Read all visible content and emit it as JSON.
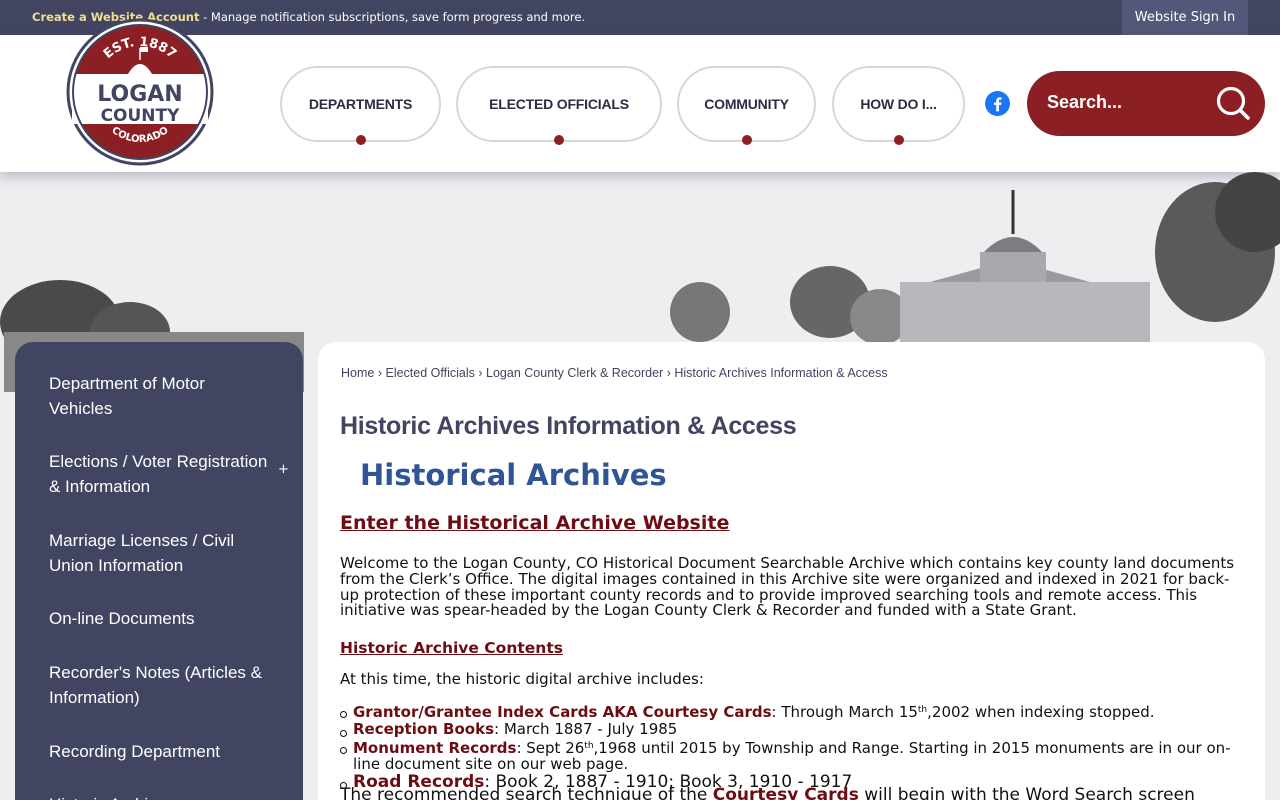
{
  "topbar": {
    "create_account": "Create a Website Account",
    "create_account_desc": " - Manage notification subscriptions, save form progress and more.",
    "sign_in": "Website Sign In"
  },
  "logo": {
    "est": "EST. 1887",
    "name_line1": "LOGAN",
    "name_line2": "COUNTY",
    "state": "COLORADO"
  },
  "nav": [
    {
      "label": "DEPARTMENTS"
    },
    {
      "label": "ELECTED OFFICIALS"
    },
    {
      "label": "COMMUNITY"
    },
    {
      "label": "HOW DO I..."
    }
  ],
  "search": {
    "placeholder": "Search..."
  },
  "sidebar": {
    "items": [
      {
        "label": "Department of Motor Vehicles"
      },
      {
        "label": "Elections / Voter Registration & Information",
        "expand": "+"
      },
      {
        "label": "Marriage Licenses / Civil Union Information"
      },
      {
        "label": "On-line Documents"
      },
      {
        "label": "Recorder's Notes (Articles & Information)"
      },
      {
        "label": "Recording Department"
      },
      {
        "label": "Historic Archives"
      }
    ]
  },
  "breadcrumb": {
    "items": [
      "Home",
      "Elected Officials",
      "Logan County Clerk & Recorder",
      "Historic Archives Information & Access"
    ],
    "separator": "›"
  },
  "main": {
    "page_title": "Historic Archives Information & Access",
    "heading": "Historical Archives",
    "enter_link": "Enter the Historical Archive Website",
    "paragraph": "Welcome to the Logan County, CO Historical Document Searchable Archive which contains key county land documents from the Clerk’s Office. The digital images contained in this Archive site were organized and indexed in 2021 for back-up protection of these important county records and to provide improved searching tools and remote access. This initiative was spear-headed by the Logan County Clerk & Recorder and funded with a State Grant.",
    "contents_link": "Historic Archive Contents ",
    "intro": "At this time, the historic digital archive includes:",
    "list": [
      {
        "title": "Grantor/Grantee Index Cards AKA Courtesy Cards",
        "pre": ": Through March 15",
        "sup": "th",
        "post": ",2002 when indexing stopped."
      },
      {
        "title": "Reception Books",
        "pre": ": March 1887 - July 1985",
        "sup": "",
        "post": ""
      },
      {
        "title": "Monument Records",
        "pre": ": Sept 26",
        "sup": "th",
        "post": ",1968 until 2015 by Township and Range. Starting in 2015 monuments are in our on-line document site on our web page."
      },
      {
        "title": "Road Records",
        "pre": ": Book 2, 1887 - 1910; Book 3, 1910 - 1917",
        "sup": "",
        "post": ""
      }
    ],
    "tail_pre": "The recommended search technique of the ",
    "tail_link": "Courtesy Cards",
    "tail_post": " will begin with the Word Search screen"
  },
  "colors": {
    "navy": "#414561",
    "maroon": "#8b1f24",
    "link_dark": "#6b0d12",
    "heading_blue": "#2f5597",
    "facebook": "#1877f2"
  }
}
